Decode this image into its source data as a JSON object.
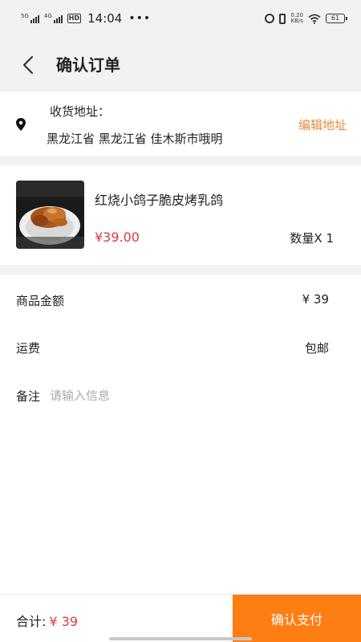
{
  "status_bar": {
    "sim1": "5G",
    "sim2": "4G",
    "hd": "HD",
    "time": "14:04",
    "more": "•••",
    "net_speed": "0.20",
    "net_unit": "KB/s",
    "battery": "61"
  },
  "header": {
    "title": "确认订单"
  },
  "address": {
    "label": "收货地址：",
    "text": "黑龙江省 黑龙江省 佳木斯市哦明",
    "edit_label": "编辑地址"
  },
  "product": {
    "name": "红烧小鸽子脆皮烤乳鸽",
    "price": "¥39.00",
    "quantity": "数量X 1"
  },
  "summary": {
    "goods_label": "商品金额",
    "goods_value": "¥ 39",
    "shipping_label": "运费",
    "shipping_value": "包邮",
    "remark_label": "备注",
    "remark_placeholder": "请输入信息"
  },
  "footer": {
    "total_label": "合计:",
    "total_value": "¥ 39",
    "pay_label": "确认支付"
  },
  "colors": {
    "accent": "#ff7e14",
    "price": "#e0393e",
    "edit_link": "#e98a3b",
    "background": "#f2f2f2"
  }
}
